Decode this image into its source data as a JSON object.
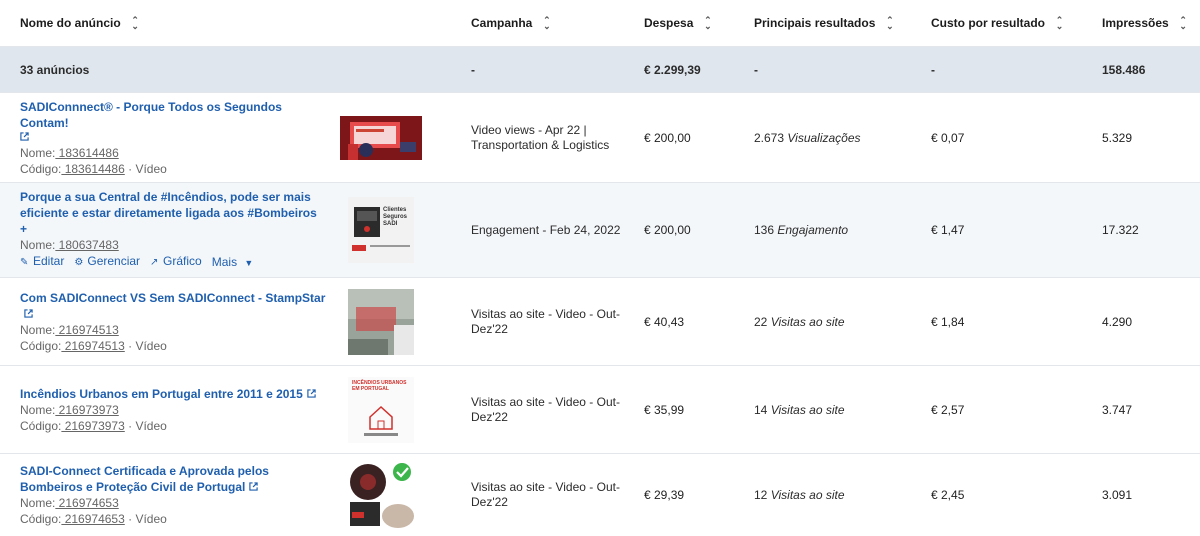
{
  "header": {
    "name": "Nome do anúncio",
    "campaign": "Campanha",
    "spend": "Despesa",
    "results": "Principais resultados",
    "cost": "Custo por resultado",
    "impressions": "Impressões"
  },
  "summary": {
    "name": "33 anúncios",
    "campaign": "-",
    "spend": "€ 2.299,39",
    "results": "-",
    "cost": "-",
    "impressions": "158.486"
  },
  "ads": [
    {
      "title": "SADIConnnect® - Porque Todos os Segundos Contam!",
      "name_label": "Nome:",
      "name_value": " 183614486",
      "code_label": "Código:",
      "code_value": " 183614486",
      "type": " · Vídeo",
      "thumb_text": "",
      "campaign": "Video views - Apr 22 | Transportation & Logistics",
      "spend": "€ 200,00",
      "result_num": "2.673",
      "result_label": "Visualizações",
      "cost": "€ 0,07",
      "impressions": "5.329"
    },
    {
      "title": "Porque a sua Central de #Incêndios, pode ser mais eficiente e estar diretamente ligada aos #Bombeiros +",
      "name_label": "Nome:",
      "name_value": " 180637483",
      "actions": {
        "edit": "Editar",
        "manage": "Gerenciar",
        "chart": "Gráfico",
        "more": "Mais"
      },
      "thumb_text": "Clientes Seguros SADI",
      "campaign": "Engagement - Feb 24, 2022",
      "spend": "€ 200,00",
      "result_num": "136",
      "result_label": "Engajamento",
      "cost": "€ 1,47",
      "impressions": "17.322"
    },
    {
      "title": "Com SADIConnect VS Sem SADIConnect - StampStar",
      "name_label": "Nome:",
      "name_value": " 216974513",
      "code_label": "Código:",
      "code_value": " 216974513",
      "type": " · Vídeo",
      "campaign": "Visitas ao site - Video - Out-Dez'22",
      "spend": "€ 40,43",
      "result_num": "22",
      "result_label": "Visitas ao site",
      "cost": "€ 1,84",
      "impressions": "4.290"
    },
    {
      "title": "Incêndios Urbanos em Portugal entre 2011 e 2015",
      "name_label": "Nome:",
      "name_value": " 216973973",
      "code_label": "Código:",
      "code_value": " 216973973",
      "type": " · Vídeo",
      "thumb_text": "INCÊNDIOS URBANOS EM PORTUGAL",
      "campaign": "Visitas ao site - Video - Out-Dez'22",
      "spend": "€ 35,99",
      "result_num": "14",
      "result_label": "Visitas ao site",
      "cost": "€ 2,57",
      "impressions": "3.747"
    },
    {
      "title": "SADI-Connect Certificada e Aprovada pelos Bombeiros e Proteção Civil de Portugal",
      "name_label": "Nome:",
      "name_value": " 216974653",
      "code_label": "Código:",
      "code_value": " 216974653",
      "type": " · Vídeo",
      "campaign": "Visitas ao site - Video - Out-Dez'22",
      "spend": "€ 29,39",
      "result_num": "12",
      "result_label": "Visitas ao site",
      "cost": "€ 2,45",
      "impressions": "3.091"
    }
  ],
  "colors": {
    "link": "#1f5fae",
    "summary_bg": "#dfe6ee",
    "alt_row": "#f4f7fa",
    "brand_red": "#d0312d"
  },
  "icons": [
    "sort-icon",
    "external-link-icon",
    "pencil-icon",
    "gear-icon",
    "chart-icon",
    "caret-down-icon"
  ]
}
